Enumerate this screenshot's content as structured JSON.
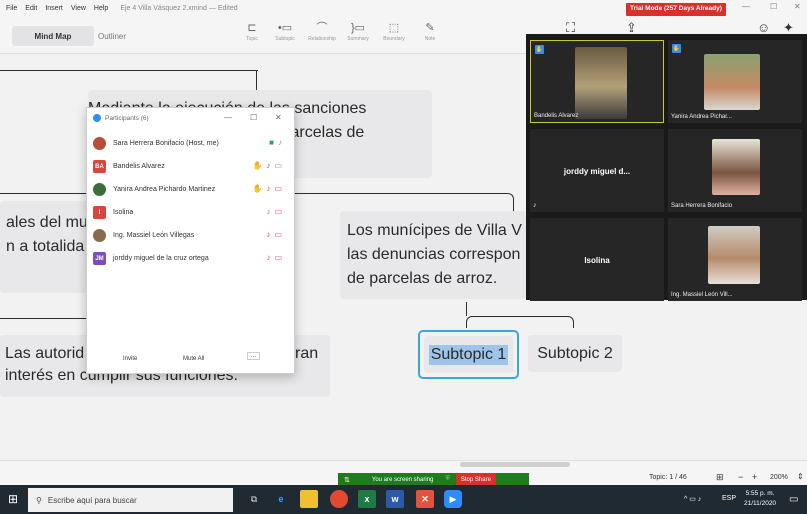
{
  "menubar": {
    "items": [
      "File",
      "Edit",
      "Insert",
      "View",
      "Help"
    ],
    "document_title": "Eje 4 Villa Vásquez 2.xmind — Edited"
  },
  "trial_badge": "Trial Mode (257 Days Already)",
  "toolbar": {
    "tab_mindmap": "Mind Map",
    "tab_outliner": "Outliner",
    "tools": [
      "Topic",
      "Subtopic",
      "Relationship",
      "Summary",
      "Boundary",
      "Note"
    ]
  },
  "canvas": {
    "topic_top": [
      "Mediante la ejecución de las sanciones",
      "Villa Vásquez la quema de parcelas de"
    ],
    "topic_left": [
      "ales del mu",
      "n a totalida"
    ],
    "topic_mid": [
      "Los munícipes de Villa V",
      "las denuncias correspon",
      "de parcelas de arroz."
    ],
    "topic_bottom": [
      "Las autorid",
      "interés en cumplir sus funciones."
    ],
    "topic_bottom_right": "ran",
    "subtopic_1": "Subtopic 1",
    "subtopic_2": "Subtopic 2"
  },
  "participants": {
    "title": "Participants (6)",
    "list": [
      {
        "name": "Sara Herrera Bonifacio (Host, me)",
        "initials": "",
        "color": "#b84d3a"
      },
      {
        "name": "Bandelis Alvarez",
        "initials": "BA",
        "color": "#d9463b"
      },
      {
        "name": "Yanira Andrea Pichardo Martinez",
        "initials": "",
        "color": "#3a6e3a"
      },
      {
        "name": "Isolina",
        "initials": "I",
        "color": "#d9463b"
      },
      {
        "name": "Ing. Massiel León Villegas",
        "initials": "",
        "color": "#8a6a4a"
      },
      {
        "name": "jorddy miguel de la cruz ortega",
        "initials": "JM",
        "color": "#7b4fbf"
      }
    ],
    "invite": "Invite",
    "mute_all": "Mute All",
    "more": "..."
  },
  "video": {
    "tiles": [
      {
        "name": "Bandelis Alvarez"
      },
      {
        "name": "Yanira Andrea Pichar..."
      },
      {
        "name": "jorddy miguel d..."
      },
      {
        "name": "Sara Herrera Bonifacio"
      },
      {
        "name": "Isolina"
      },
      {
        "name": "Ing. Massiel León Vill..."
      }
    ]
  },
  "statusbar": {
    "topic_count": "Topic: 1 / 46",
    "zoom": "200%"
  },
  "sharing": {
    "text": "You are screen sharing",
    "stop": "Stop Share"
  },
  "taskbar": {
    "search_placeholder": "Escribe aquí para buscar",
    "lang": "ESP",
    "time": "5:55 p. m.",
    "date": "21/11/2020"
  }
}
